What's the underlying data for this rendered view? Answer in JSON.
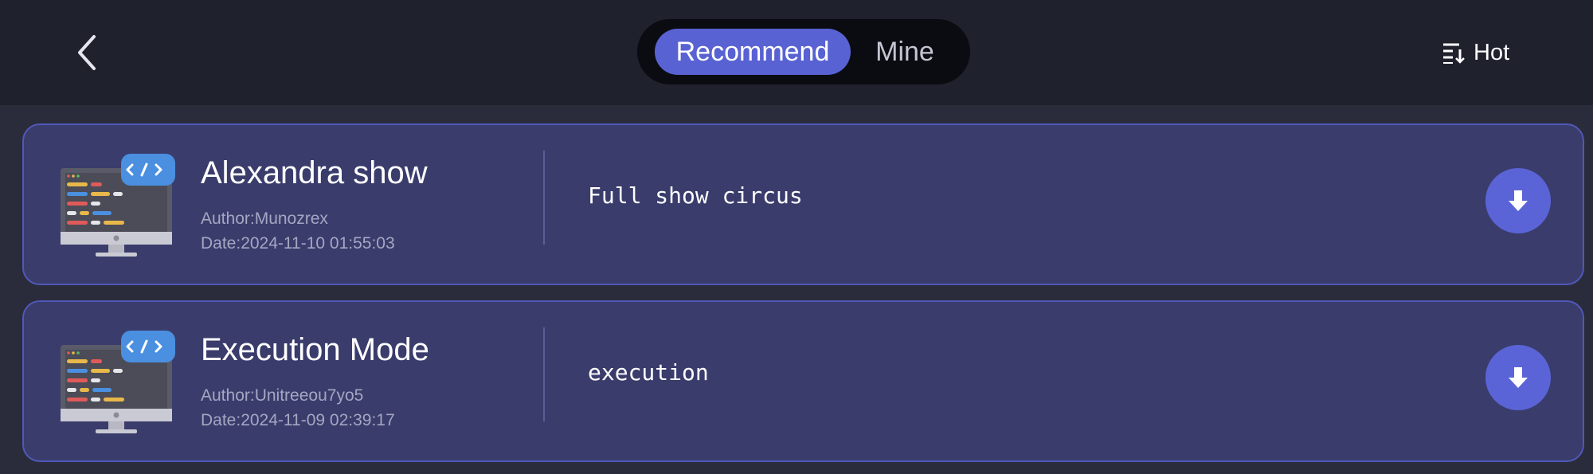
{
  "header": {
    "back_icon": "chevron-left-icon",
    "tabs": [
      {
        "label": "Recommend",
        "active": true
      },
      {
        "label": "Mine",
        "active": false
      }
    ],
    "sort": {
      "icon": "sort-list-icon",
      "label": "Hot"
    }
  },
  "programs": [
    {
      "title": "Alexandra show",
      "author": "Author:Munozrex",
      "date": "Date:2024-11-10 01:55:03",
      "description": "Full show circus",
      "thumbnail_icon": "code-monitor-icon",
      "action_icon": "download-icon"
    },
    {
      "title": "Execution Mode",
      "author": "Author:Unitreeou7yo5",
      "date": "Date:2024-11-09 02:39:17",
      "description": "execution",
      "thumbnail_icon": "code-monitor-icon",
      "action_icon": "download-icon"
    }
  ],
  "colors": {
    "background": "#2a2c3b",
    "header_bg": "#1f212d",
    "card_bg": "#3a3c6c",
    "card_border": "#5058b8",
    "accent": "#5862d2"
  }
}
